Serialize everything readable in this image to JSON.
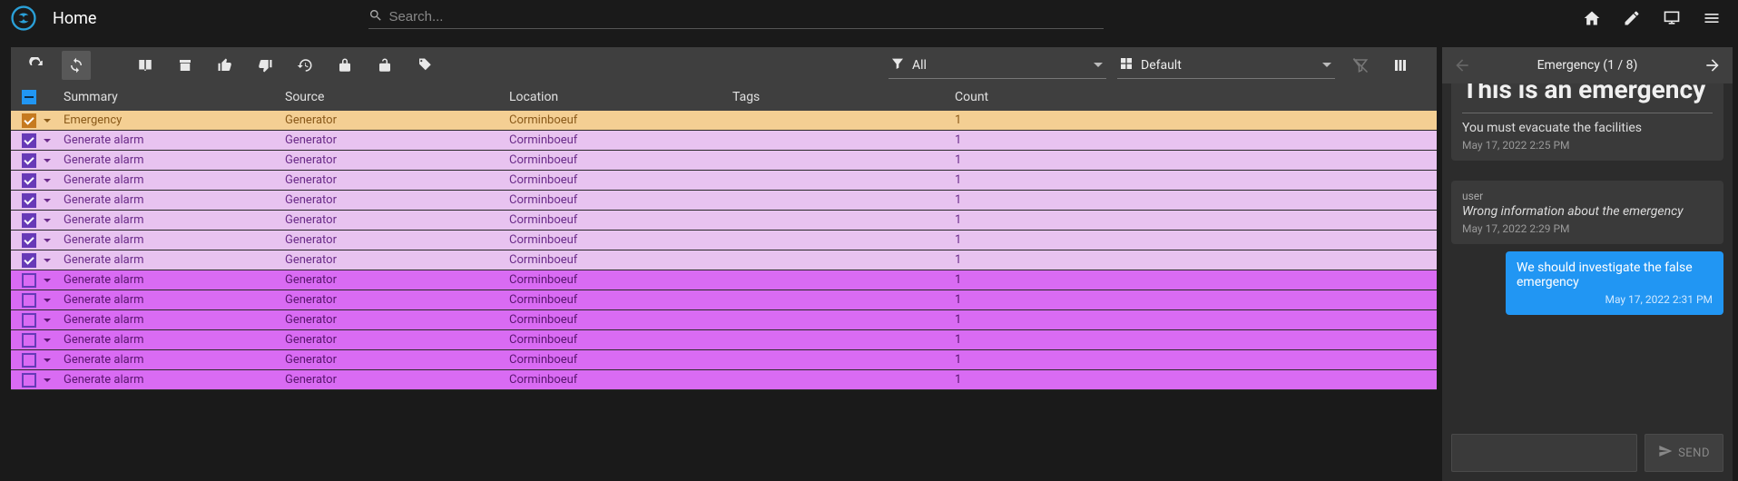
{
  "header": {
    "title": "Home",
    "search_placeholder": "Search..."
  },
  "toolbar": {
    "filter_label": "All",
    "view_label": "Default"
  },
  "columns": {
    "summary": "Summary",
    "source": "Source",
    "location": "Location",
    "tags": "Tags",
    "count": "Count"
  },
  "rows": [
    {
      "summary": "Emergency",
      "source": "Generator",
      "location": "Corminboeuf",
      "tags": "",
      "count": "1",
      "checked": true,
      "variant": "orange"
    },
    {
      "summary": "Generate alarm",
      "source": "Generator",
      "location": "Corminboeuf",
      "tags": "",
      "count": "1",
      "checked": true,
      "variant": "lav"
    },
    {
      "summary": "Generate alarm",
      "source": "Generator",
      "location": "Corminboeuf",
      "tags": "",
      "count": "1",
      "checked": true,
      "variant": "lav"
    },
    {
      "summary": "Generate alarm",
      "source": "Generator",
      "location": "Corminboeuf",
      "tags": "",
      "count": "1",
      "checked": true,
      "variant": "lav"
    },
    {
      "summary": "Generate alarm",
      "source": "Generator",
      "location": "Corminboeuf",
      "tags": "",
      "count": "1",
      "checked": true,
      "variant": "lav"
    },
    {
      "summary": "Generate alarm",
      "source": "Generator",
      "location": "Corminboeuf",
      "tags": "",
      "count": "1",
      "checked": true,
      "variant": "lav"
    },
    {
      "summary": "Generate alarm",
      "source": "Generator",
      "location": "Corminboeuf",
      "tags": "",
      "count": "1",
      "checked": true,
      "variant": "lav"
    },
    {
      "summary": "Generate alarm",
      "source": "Generator",
      "location": "Corminboeuf",
      "tags": "",
      "count": "1",
      "checked": true,
      "variant": "lav"
    },
    {
      "summary": "Generate alarm",
      "source": "Generator",
      "location": "Corminboeuf",
      "tags": "",
      "count": "1",
      "checked": false,
      "variant": "magenta"
    },
    {
      "summary": "Generate alarm",
      "source": "Generator",
      "location": "Corminboeuf",
      "tags": "",
      "count": "1",
      "checked": false,
      "variant": "magenta"
    },
    {
      "summary": "Generate alarm",
      "source": "Generator",
      "location": "Corminboeuf",
      "tags": "",
      "count": "1",
      "checked": false,
      "variant": "magenta"
    },
    {
      "summary": "Generate alarm",
      "source": "Generator",
      "location": "Corminboeuf",
      "tags": "",
      "count": "1",
      "checked": false,
      "variant": "magenta"
    },
    {
      "summary": "Generate alarm",
      "source": "Generator",
      "location": "Corminboeuf",
      "tags": "",
      "count": "1",
      "checked": false,
      "variant": "magenta"
    },
    {
      "summary": "Generate alarm",
      "source": "Generator",
      "location": "Corminboeuf",
      "tags": "",
      "count": "1",
      "checked": false,
      "variant": "magenta"
    }
  ],
  "detail": {
    "title": "Emergency (1 / 8)",
    "heading": "This is an emergency",
    "messages": [
      {
        "kind": "system",
        "text": "You must evacuate the facilities",
        "ts": "May 17, 2022 2:25 PM"
      },
      {
        "kind": "user",
        "who": "user",
        "text": "Wrong information about the emergency",
        "ts": "May 17, 2022 2:29 PM"
      },
      {
        "kind": "me",
        "text": "We should investigate the false emergency",
        "ts": "May 17, 2022 2:31 PM"
      }
    ],
    "send_label": "SEND"
  }
}
